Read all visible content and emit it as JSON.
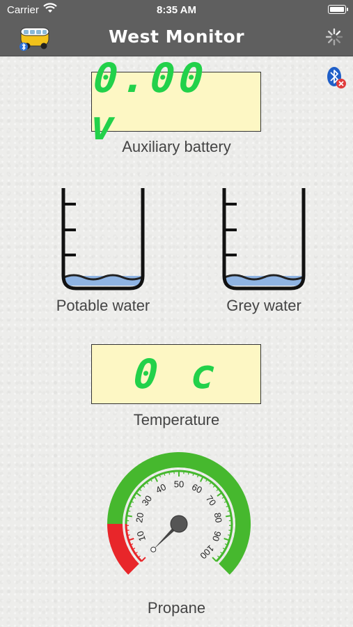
{
  "status_bar": {
    "carrier": "Carrier",
    "time": "8:35 AM"
  },
  "nav": {
    "title": "West Monitor",
    "left_icon": "van-bluetooth-icon",
    "right_icon": "activity-spinner-icon"
  },
  "bluetooth_status": {
    "icon": "bluetooth-disconnected-icon",
    "badge_color": "#e03c3c"
  },
  "battery": {
    "reading": "0.00 v",
    "label": "Auxiliary battery"
  },
  "tanks": [
    {
      "label": "Potable water",
      "level": 0.1
    },
    {
      "label": "Grey water",
      "level": 0.1
    }
  ],
  "temperature": {
    "reading": "0 c",
    "label": "Temperature"
  },
  "propane": {
    "label": "Propane",
    "value": 0,
    "scale_labels": [
      "10",
      "20",
      "30",
      "40",
      "50",
      "60",
      "70",
      "80",
      "90",
      "100"
    ]
  },
  "colors": {
    "lcd_bg": "#fdf7c4",
    "lcd_text": "#22d14a",
    "gauge_green": "#46b82e",
    "gauge_red": "#e8262a",
    "water": "#8fb4e3"
  }
}
